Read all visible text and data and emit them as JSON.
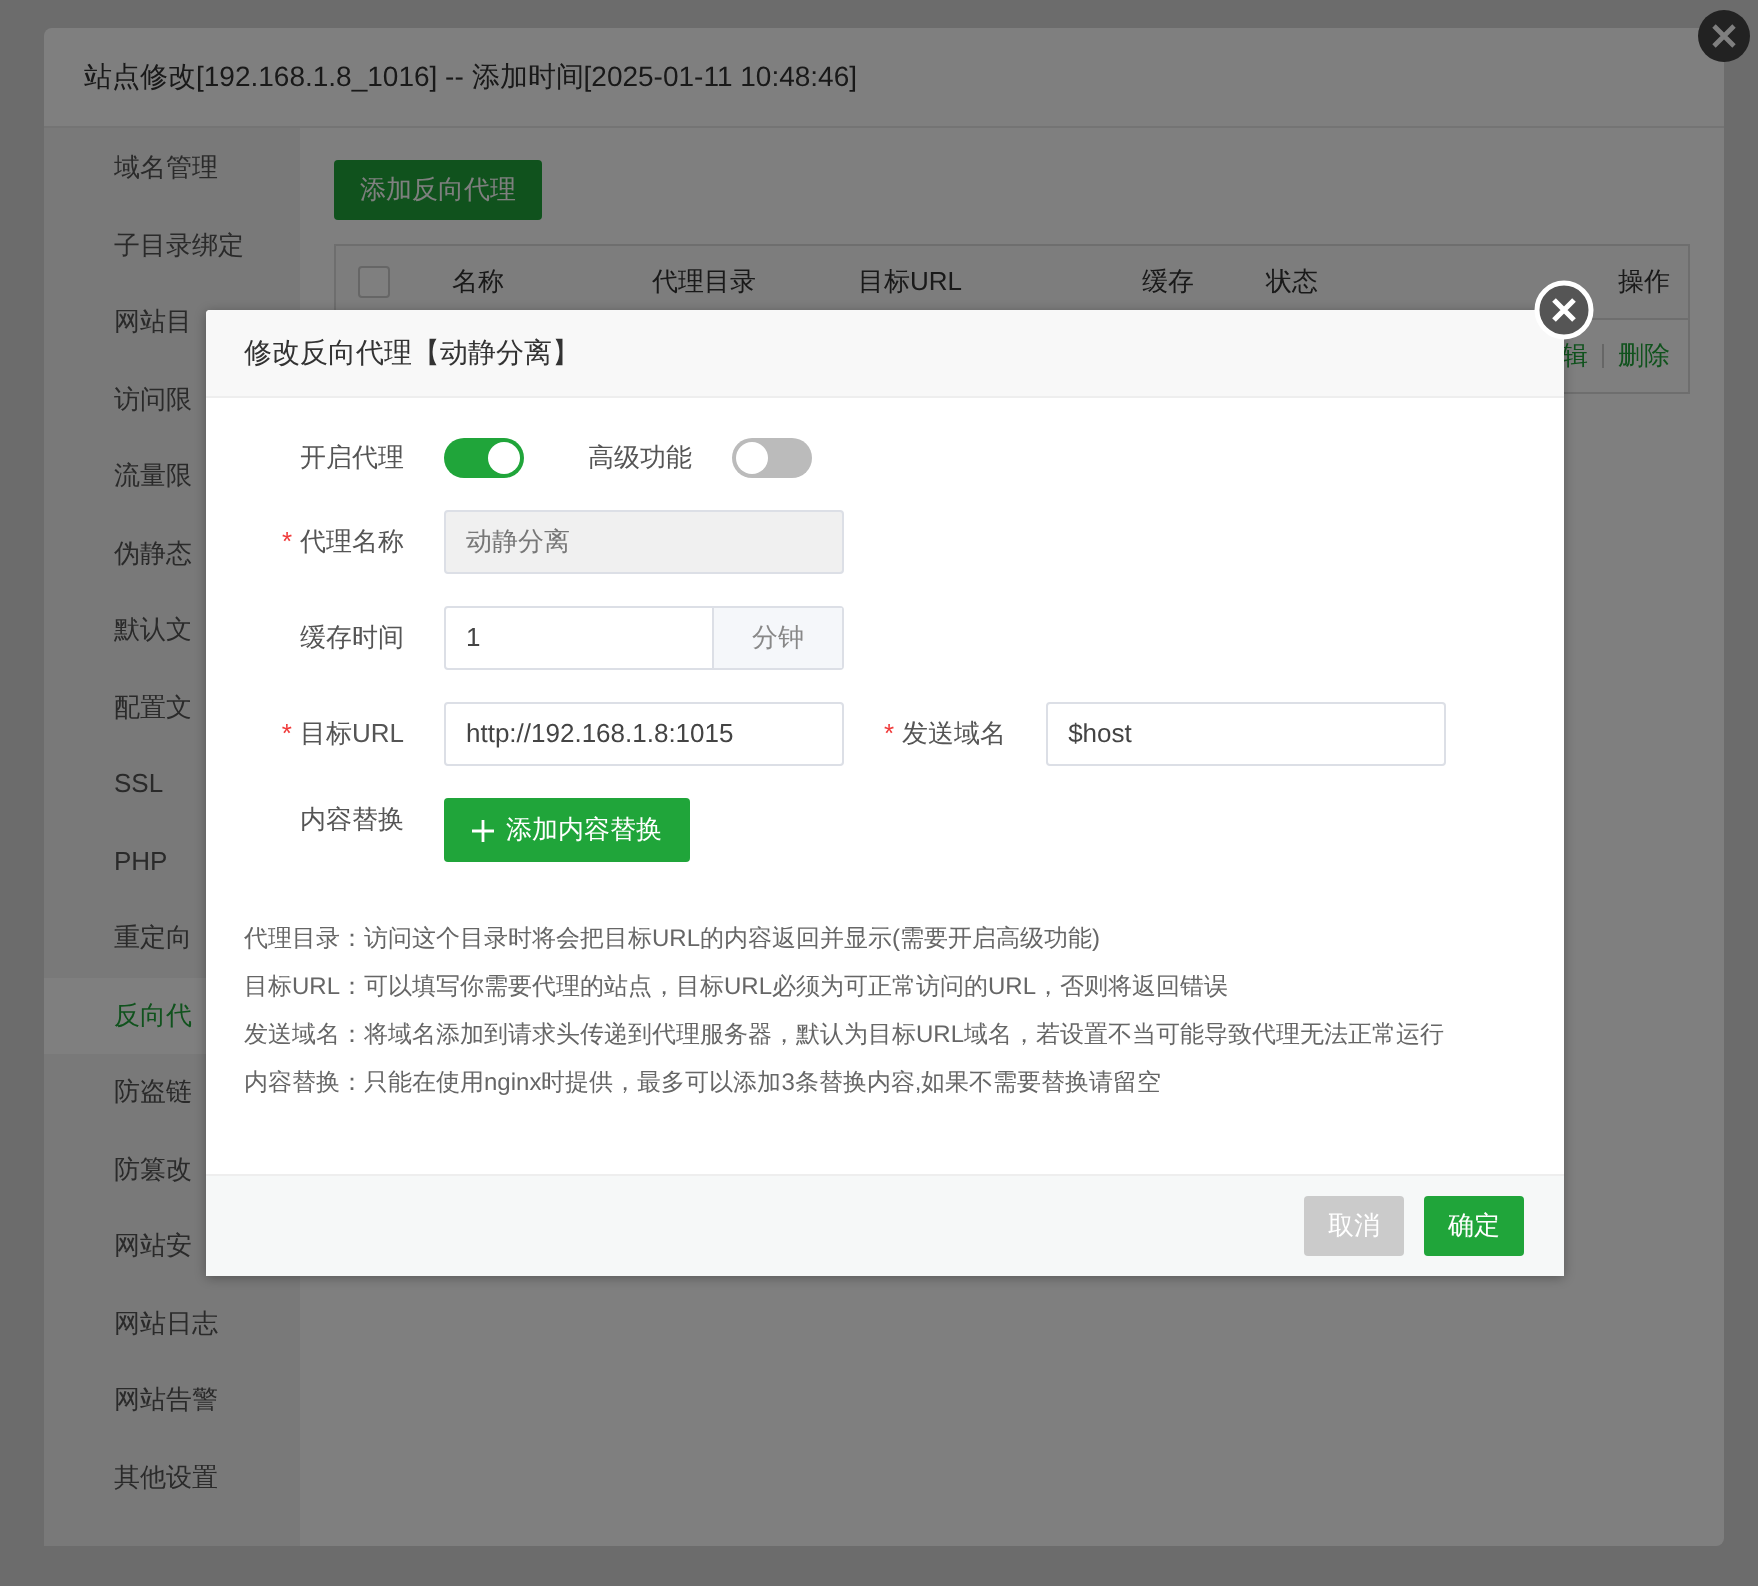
{
  "window": {
    "title": "站点修改[192.168.1.8_1016] -- 添加时间[2025-01-11 10:48:46]"
  },
  "sidebar": {
    "items": [
      {
        "label": "域名管理",
        "selected": false
      },
      {
        "label": "子目录绑定",
        "selected": false
      },
      {
        "label": "网站目",
        "selected": false
      },
      {
        "label": "访问限",
        "selected": false
      },
      {
        "label": "流量限",
        "selected": false
      },
      {
        "label": "伪静态",
        "selected": false
      },
      {
        "label": "默认文",
        "selected": false
      },
      {
        "label": "配置文",
        "selected": false
      },
      {
        "label": "SSL",
        "selected": false
      },
      {
        "label": "PHP",
        "selected": false
      },
      {
        "label": "重定向",
        "selected": false
      },
      {
        "label": "反向代",
        "selected": true
      },
      {
        "label": "防盗链",
        "selected": false
      },
      {
        "label": "防篡改",
        "selected": false
      },
      {
        "label": "网站安",
        "selected": false
      },
      {
        "label": "网站日志",
        "selected": false
      },
      {
        "label": "网站告警",
        "selected": false
      },
      {
        "label": "其他设置",
        "selected": false
      }
    ]
  },
  "content": {
    "add_button": "添加反向代理",
    "table": {
      "select_all": {
        "checked": false
      },
      "columns": [
        "名称",
        "代理目录",
        "目标URL",
        "缓存",
        "状态",
        "操作"
      ],
      "rows": [
        {
          "actions": [
            "辑",
            "删除"
          ]
        }
      ]
    }
  },
  "dialog": {
    "title": "修改反向代理【动静分离】",
    "form_rows": [
      {
        "kind": "switch",
        "items": [
          {
            "label": "开启代理",
            "on": true
          },
          {
            "label": "高级功能",
            "on": false
          }
        ]
      },
      {
        "kind": "input",
        "items": [
          {
            "label": "代理名称",
            "required_mark": "*",
            "value": "动静分离",
            "disabled": true
          }
        ]
      },
      {
        "kind": "input",
        "items": [
          {
            "label": "缓存时间",
            "value": "1",
            "suffix": "分钟",
            "disabled": false
          }
        ]
      },
      {
        "kind": "input",
        "items": [
          {
            "label": "目标URL",
            "required_mark": "*",
            "value": "http://192.168.1.8:1015",
            "disabled": false
          },
          {
            "label": "发送域名",
            "required_mark": "*",
            "value": "$host",
            "disabled": false
          }
        ]
      },
      {
        "kind": "button",
        "label": "内容替换",
        "button": "添加内容替换"
      }
    ],
    "notes": [
      "代理目录：访问这个目录时将会把目标URL的内容返回并显示(需要开启高级功能)",
      "目标URL：可以填写你需要代理的站点，目标URL必须为可正常访问的URL，否则将返回错误",
      "发送域名：将域名添加到请求头传递到代理服务器，默认为目标URL域名，若设置不当可能导致代理无法正常运行",
      "内容替换：只能在使用nginx时提供，最多可以添加3条替换内容,如果不需要替换请留空"
    ],
    "buttons": [
      {
        "label": "取消",
        "kind": "cancel"
      },
      {
        "label": "确定",
        "kind": "primary"
      }
    ]
  }
}
